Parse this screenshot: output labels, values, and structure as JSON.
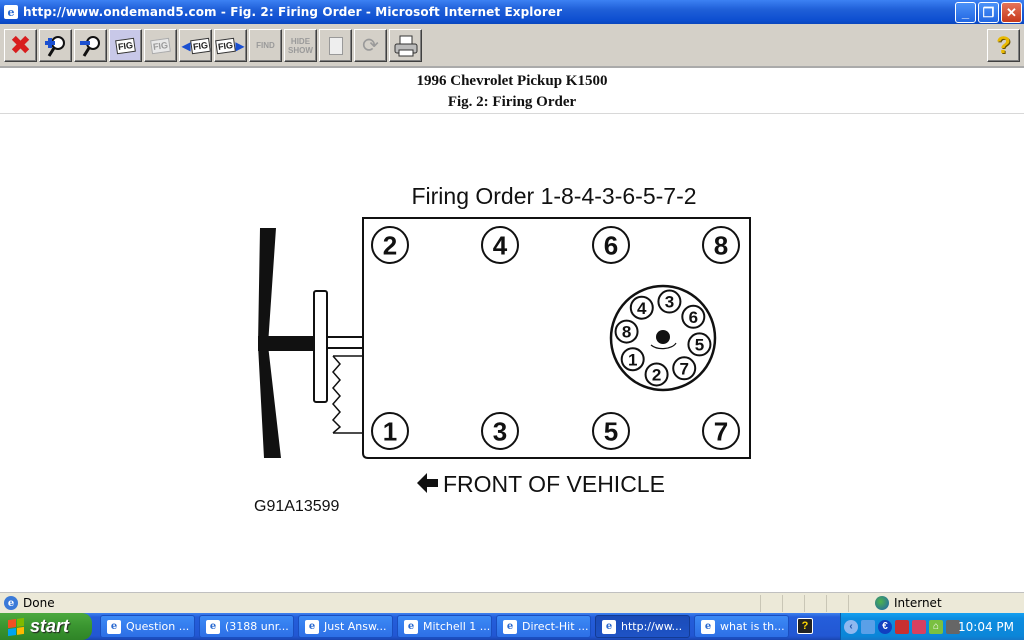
{
  "window": {
    "title": "http://www.ondemand5.com - Fig. 2: Firing Order - Microsoft Internet Explorer",
    "minimize_glyph": "_",
    "restore_glyph": "❐",
    "close_glyph": "✕"
  },
  "toolbar": {
    "buttons": [
      {
        "name": "close",
        "icon": "red-x-icon",
        "enabled": true
      },
      {
        "name": "zoom-in",
        "icon": "zoom-in-icon",
        "enabled": true
      },
      {
        "name": "zoom-out",
        "icon": "zoom-out-icon",
        "enabled": true
      },
      {
        "name": "figure-window",
        "icon": "fig-window-icon",
        "label": "FIG",
        "enabled": true
      },
      {
        "name": "figure-select",
        "icon": "fig-hand-icon",
        "label": "FIG",
        "enabled": false
      },
      {
        "name": "previous-figure",
        "icon": "fig-previous-icon",
        "label": "FIG",
        "enabled": true
      },
      {
        "name": "next-figure",
        "icon": "fig-next-icon",
        "label": "FIG",
        "enabled": true
      },
      {
        "name": "find",
        "icon": "find-icon",
        "label": "FIND",
        "enabled": false
      },
      {
        "name": "hide-show",
        "icon": "hide-show-icon",
        "label_top": "HIDE",
        "label_bottom": "SHOW",
        "enabled": false
      },
      {
        "name": "notes",
        "icon": "notes-icon",
        "enabled": false
      },
      {
        "name": "refresh",
        "icon": "refresh-icon",
        "enabled": false
      },
      {
        "name": "print",
        "icon": "printer-icon",
        "enabled": true
      }
    ],
    "help_glyph": "?"
  },
  "header": {
    "vehicle": "1996 Chevrolet Pickup K1500",
    "figure_title": "Fig. 2: Firing Order"
  },
  "figure": {
    "firing_order_label": "Firing Order 1-8-4-3-6-5-7-2",
    "cylinders_top_row": [
      "2",
      "4",
      "6",
      "8"
    ],
    "cylinders_bottom_row": [
      "1",
      "3",
      "5",
      "7"
    ],
    "distributor_terminals_clockwise_from_top": [
      "3",
      "6",
      "5",
      "7",
      "2",
      "1",
      "8",
      "4"
    ],
    "front_label": "FRONT OF VEHICLE",
    "front_arrow": "left-arrow-icon",
    "figure_code": "G91A13599"
  },
  "statusbar": {
    "status": "Done",
    "zone": "Internet"
  },
  "taskbar": {
    "start_label": "start",
    "tasks": [
      {
        "label": "Question ...",
        "active": false
      },
      {
        "label": "(3188 unr...",
        "active": false
      },
      {
        "label": "Just Answ...",
        "active": false
      },
      {
        "label": "Mitchell 1 ...",
        "active": false
      },
      {
        "label": "Direct-Hit ...",
        "active": false
      },
      {
        "label": "http://ww...",
        "active": true
      },
      {
        "label": "what is th...",
        "active": false
      }
    ],
    "clock": "10:04 PM"
  }
}
